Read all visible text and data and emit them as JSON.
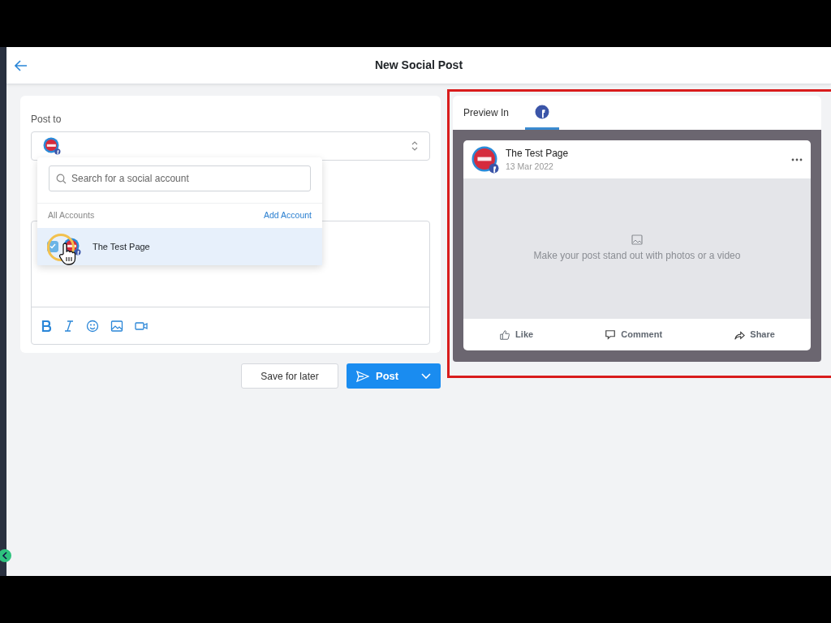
{
  "header": {
    "title": "New Social Post"
  },
  "composer": {
    "post_to_label": "Post to",
    "selected_accounts": [
      {
        "kind": "facebook"
      }
    ]
  },
  "dropdown": {
    "search_placeholder": "Search for a social account",
    "section_label": "All Accounts",
    "add_link": "Add Account",
    "accounts": [
      {
        "name": "The Test Page",
        "kind": "facebook",
        "checked": true,
        "selected": true
      }
    ]
  },
  "actions": {
    "save": "Save for later",
    "post": "Post"
  },
  "preview": {
    "label": "Preview In",
    "tabs": [
      {
        "kind": "facebook",
        "selected": true
      }
    ],
    "post": {
      "page_name": "The Test Page",
      "date": "13 Mar 2022",
      "media_hint": "Make your post stand out with photos or a video",
      "actions": [
        {
          "kind": "like",
          "label": "Like"
        },
        {
          "kind": "comment",
          "label": "Comment"
        },
        {
          "kind": "share",
          "label": "Share"
        }
      ]
    }
  }
}
